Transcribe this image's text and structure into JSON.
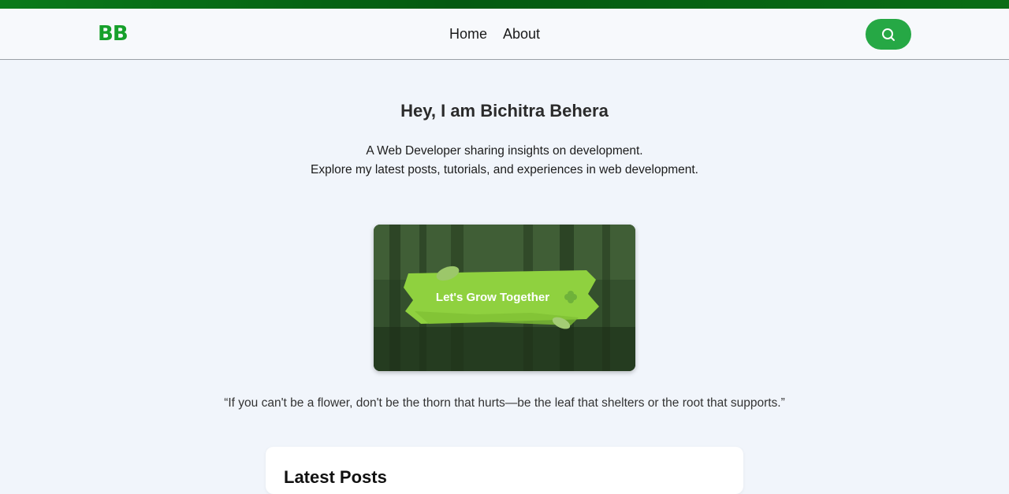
{
  "header": {
    "logo": "BB",
    "nav": [
      {
        "label": "Home"
      },
      {
        "label": "About"
      }
    ],
    "search_icon": "search-icon"
  },
  "hero": {
    "title": "Hey, I am Bichitra Behera",
    "subtitle_line1": "A Web Developer sharing insights on development.",
    "subtitle_line2": "Explore my latest posts, tutorials, and experiences in web development."
  },
  "banner": {
    "text": "Let's Grow Together"
  },
  "quote": "“If you can't be a flower, don't be the thorn that hurts—be the leaf that shelters or the root that supports.”",
  "latest_posts": {
    "title": "Latest Posts"
  },
  "colors": {
    "brand": "#16a02b",
    "search_button": "#26a845",
    "top_strip": "#0b7a1a",
    "banner_brush": "#8fd13f"
  }
}
